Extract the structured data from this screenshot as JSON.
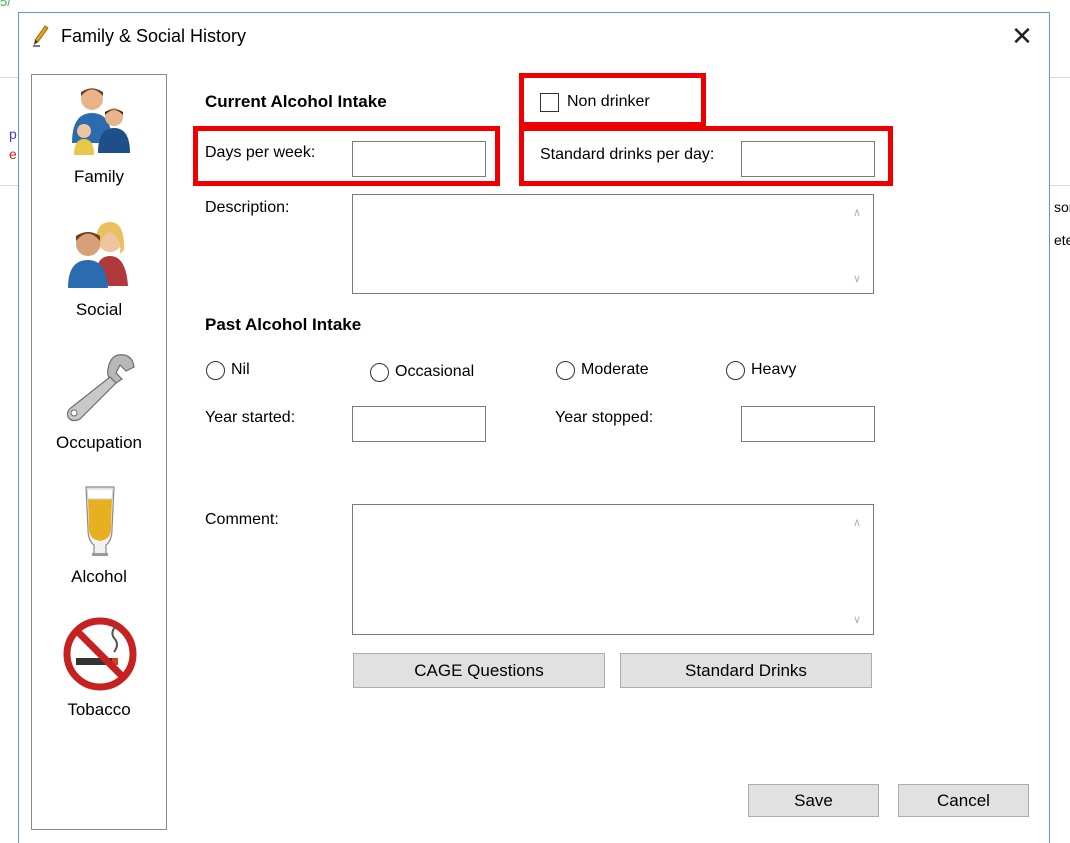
{
  "dialog": {
    "title": "Family & Social History",
    "close_glyph": "✕"
  },
  "background_fragments": {
    "top_left": "5/",
    "left_p": "p",
    "left_e": "e",
    "right_1": "sor",
    "right_2": "ete"
  },
  "nav": {
    "items": [
      {
        "label": "Family",
        "icon": "family-icon"
      },
      {
        "label": "Social",
        "icon": "couple-icon"
      },
      {
        "label": "Occupation",
        "icon": "wrench-icon"
      },
      {
        "label": "Alcohol",
        "icon": "beer-glass-icon"
      },
      {
        "label": "Tobacco",
        "icon": "no-smoking-icon"
      }
    ]
  },
  "form": {
    "current_heading": "Current Alcohol Intake",
    "non_drinker_label": "Non drinker",
    "non_drinker_checked": false,
    "days_per_week_label": "Days per week:",
    "days_per_week_value": "",
    "std_drinks_label": "Standard drinks per day:",
    "std_drinks_value": "",
    "description_label": "Description:",
    "description_value": "",
    "past_heading": "Past Alcohol Intake",
    "past_options": [
      "Nil",
      "Occasional",
      "Moderate",
      "Heavy"
    ],
    "past_selected": null,
    "year_started_label": "Year started:",
    "year_started_value": "",
    "year_stopped_label": "Year stopped:",
    "year_stopped_value": "",
    "comment_label": "Comment:",
    "comment_value": ""
  },
  "buttons": {
    "cage": "CAGE Questions",
    "standard_drinks": "Standard Drinks",
    "save": "Save",
    "cancel": "Cancel"
  },
  "colors": {
    "highlight": "#ee0000",
    "dialog_border": "#5b9bd5"
  }
}
